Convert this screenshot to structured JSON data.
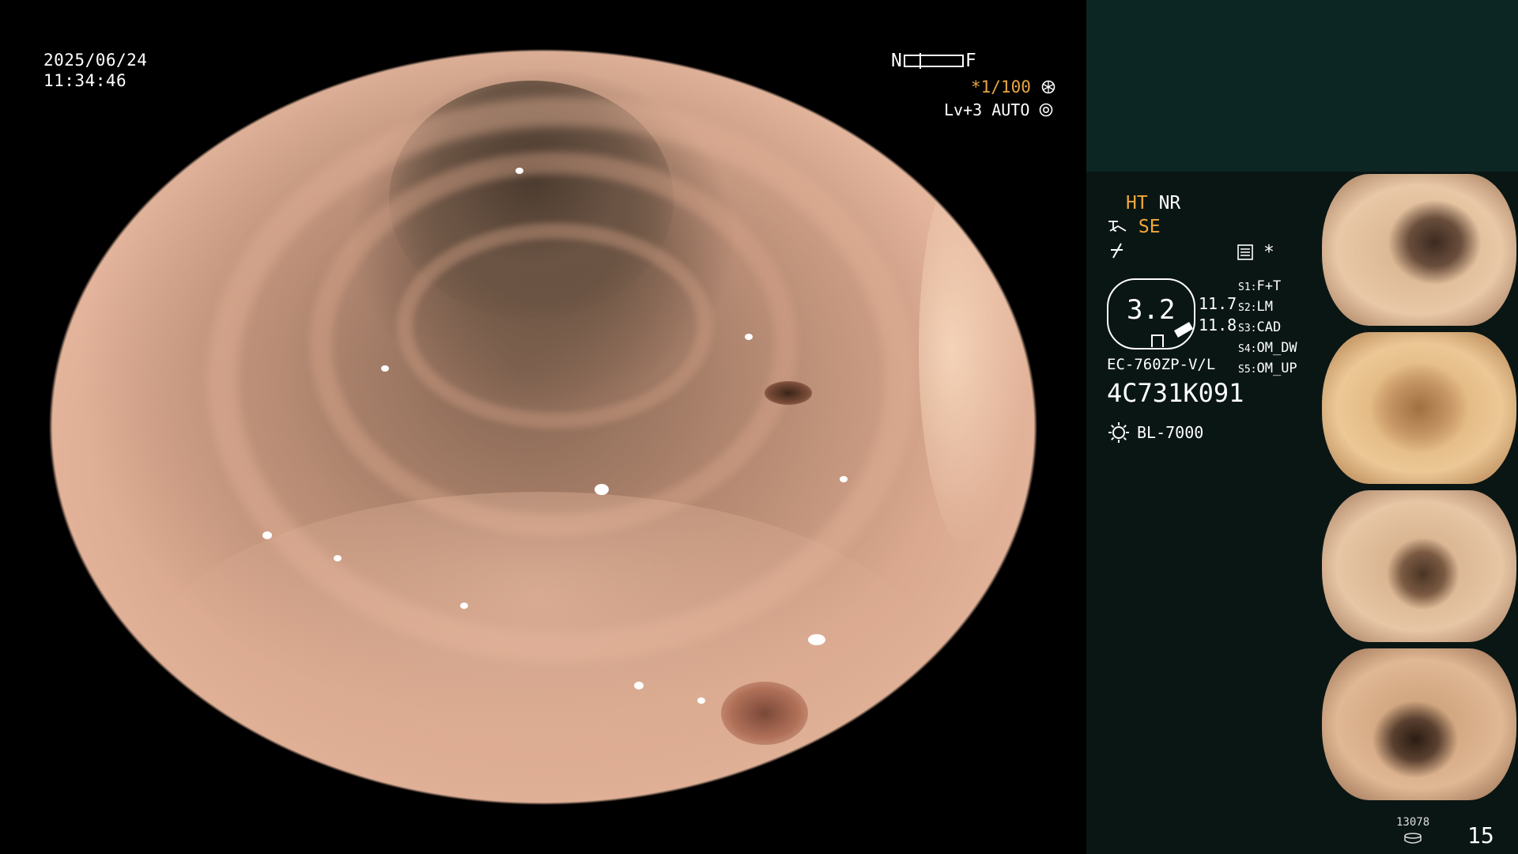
{
  "scope": {
    "date": "2025/06/24",
    "time": "11:34:46",
    "near_label": "N",
    "far_label": "F",
    "shutter": "*1/100",
    "level": "Lv+3 AUTO"
  },
  "panel": {
    "ht": "HT",
    "nr": "NR",
    "se": "SE",
    "asterisk": "*",
    "gauge_value": "3.2",
    "readings": [
      "11.7",
      "11.8"
    ],
    "settings": [
      {
        "key": "S1:",
        "value": "F+T"
      },
      {
        "key": "S2:",
        "value": "LM"
      },
      {
        "key": "S3:",
        "value": "CAD"
      },
      {
        "key": "S4:",
        "value": "OM_DW"
      },
      {
        "key": "S5:",
        "value": "OM_UP"
      }
    ],
    "scope_model": "EC-760ZP-V/L",
    "serial": "4C731K091",
    "light_source": "BL-7000",
    "storage_count": "13078",
    "image_count": "15"
  },
  "thumbnails": {
    "count": 4
  },
  "colors": {
    "accent_orange": "#f0a93a",
    "panel_teal": "#0c2624",
    "panel_dark": "#0a1614",
    "mucosa": "#d9a88e"
  }
}
